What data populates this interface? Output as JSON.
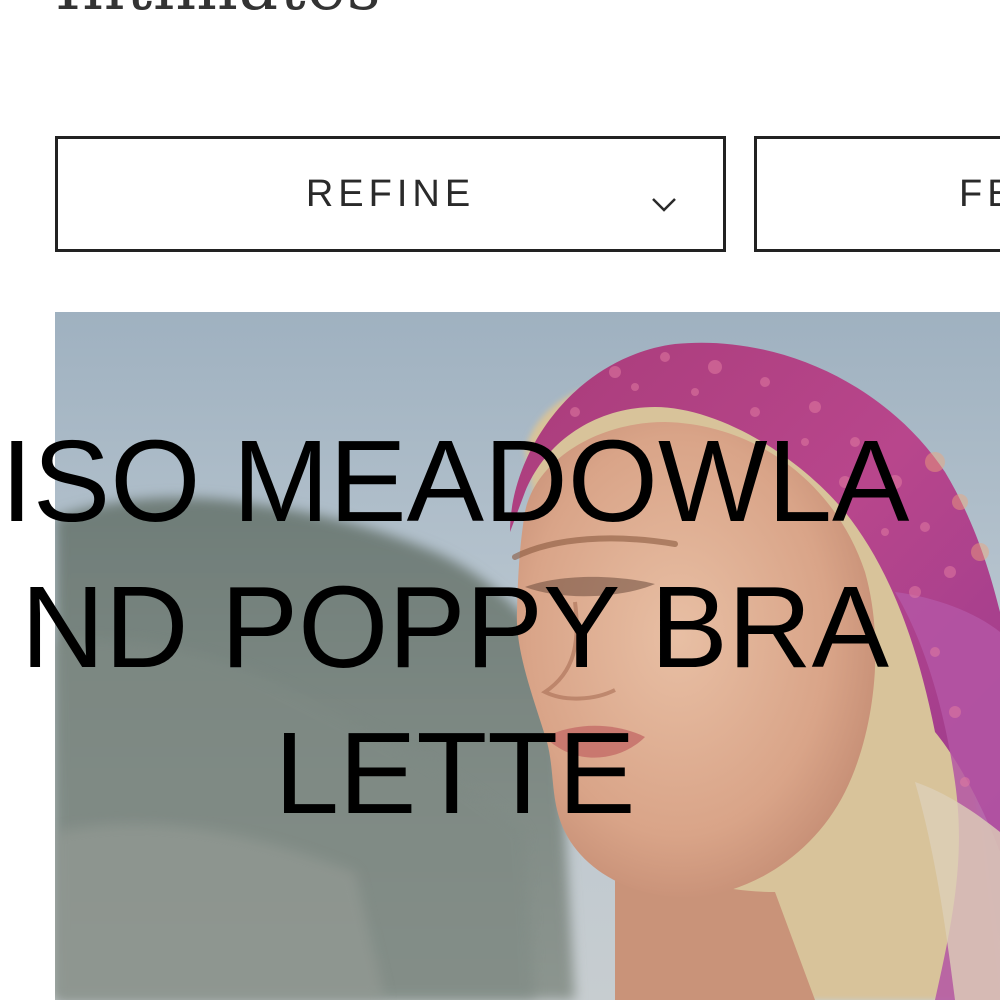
{
  "header": {
    "title": "Intimates"
  },
  "filters": {
    "refine_label": "REFINE",
    "refine_icon": "chevron-down-icon",
    "featured_label": "FE"
  },
  "product": {
    "name": "ISO MEADOWLAND POPPY BRALETTE"
  },
  "colors": {
    "border": "#222222",
    "text": "#2a2a2a",
    "scarf": "#b0407e",
    "sky": "#aebdc9"
  }
}
